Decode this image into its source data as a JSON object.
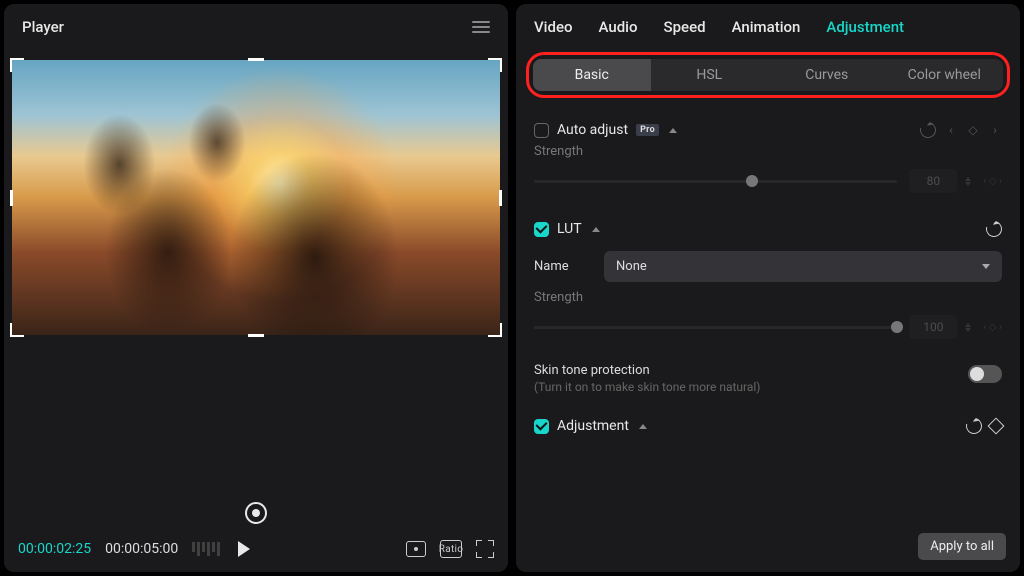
{
  "player": {
    "title": "Player",
    "current_time": "00:00:02:25",
    "total_time": "00:00:05:00",
    "ratio_label": "Ratio"
  },
  "top_tabs": [
    "Video",
    "Audio",
    "Speed",
    "Animation",
    "Adjustment"
  ],
  "top_tab_active": "Adjustment",
  "sub_tabs": [
    "Basic",
    "HSL",
    "Curves",
    "Color wheel"
  ],
  "sub_tab_active": "Basic",
  "auto_adjust": {
    "label": "Auto adjust",
    "checked": false,
    "pro_tag": "Pro",
    "strength_label": "Strength",
    "strength_value": 80
  },
  "lut": {
    "label": "LUT",
    "checked": true,
    "name_label": "Name",
    "name_value": "None",
    "strength_label": "Strength",
    "strength_value": 100,
    "skin_title": "Skin tone protection",
    "skin_sub": "(Turn it on to make skin tone more natural)",
    "skin_on": false
  },
  "adjustment_section": {
    "label": "Adjustment",
    "checked": true
  },
  "apply_label": "Apply to all"
}
